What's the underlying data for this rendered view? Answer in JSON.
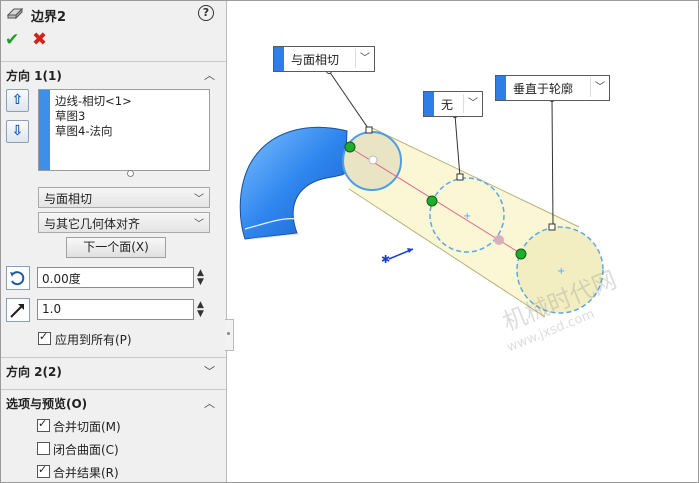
{
  "panel": {
    "title": "边界2",
    "help_icon": "?",
    "ok_icon": "✔",
    "cancel_icon": "✖",
    "direction1": {
      "header": "方向 1(1)",
      "curves": [
        "边线-相切<1>",
        "草图3",
        "草图4-法向"
      ],
      "up_icon": "⇧",
      "down_icon": "⇩",
      "tangent_type": "与面相切",
      "alignment": "与其它几何体对齐",
      "next_face_button": "下一个面(X)",
      "angle_value": "0.00度",
      "magnitude_value": "1.0",
      "apply_all_label": "应用到所有(P)",
      "apply_all_checked": true
    },
    "direction2": {
      "header": "方向 2(2)"
    },
    "options": {
      "header": "选项与预览(O)",
      "merge_faces": "合并切面(M)",
      "merge_faces_checked": true,
      "close_surface": "闭合曲面(C)",
      "close_surface_checked": false,
      "merge_result": "合并结果(R)",
      "merge_result_checked": true
    }
  },
  "viewport": {
    "callouts": [
      {
        "label": "与面相切"
      },
      {
        "label": "无"
      },
      {
        "label": "垂直于轮廓"
      }
    ],
    "watermark_line1": "机械时代网",
    "watermark_line2": "www.jxsd.com",
    "colors": {
      "accent_blue": "#2f7ee8",
      "body_yellow": "#fbf7d4",
      "profile_dash": "#5aa8e8",
      "ok_green": "#1e9e28",
      "cancel_red": "#d0231c"
    }
  }
}
